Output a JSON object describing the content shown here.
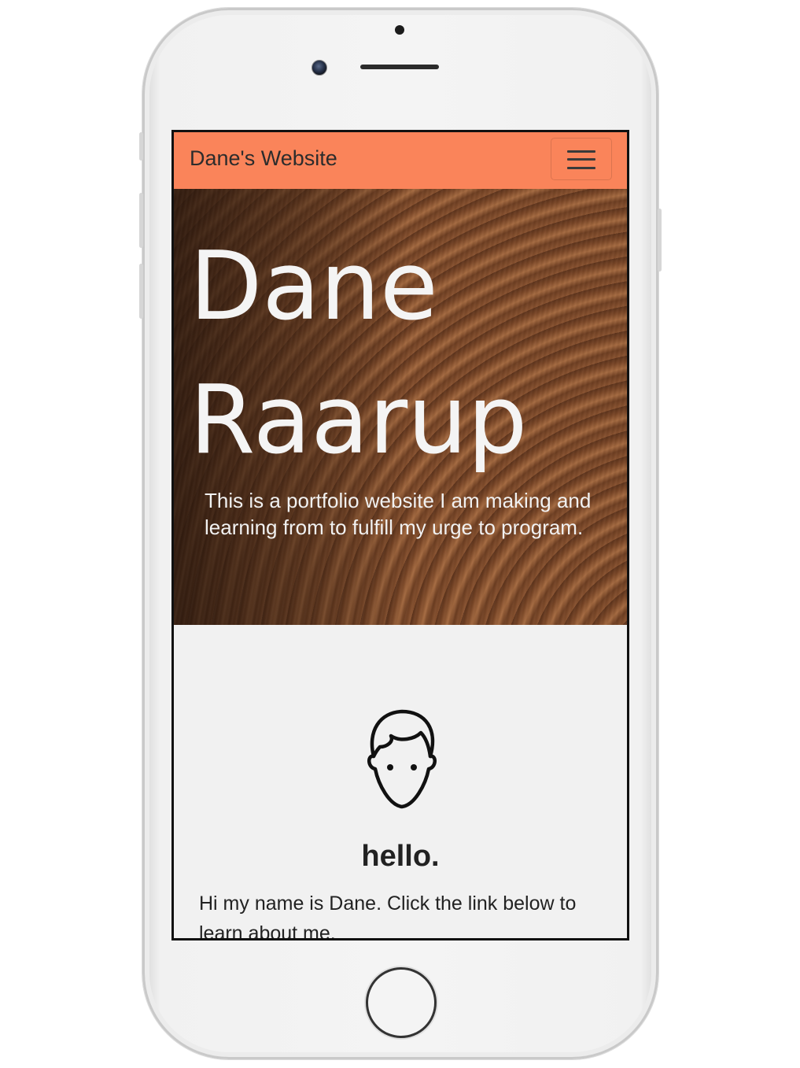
{
  "navbar": {
    "brand": "Dane's Website",
    "toggle_icon": "hamburger-menu-icon",
    "color": "#fa845a"
  },
  "hero": {
    "title_line1": "Dane",
    "title_line2": "Raarup",
    "text": "This is a portfolio website I am making and learning from to fulfill my urge to program."
  },
  "about": {
    "icon": "person-face-icon",
    "heading": "hello.",
    "text": "Hi my name is Dane. Click the link below to learn about me."
  }
}
